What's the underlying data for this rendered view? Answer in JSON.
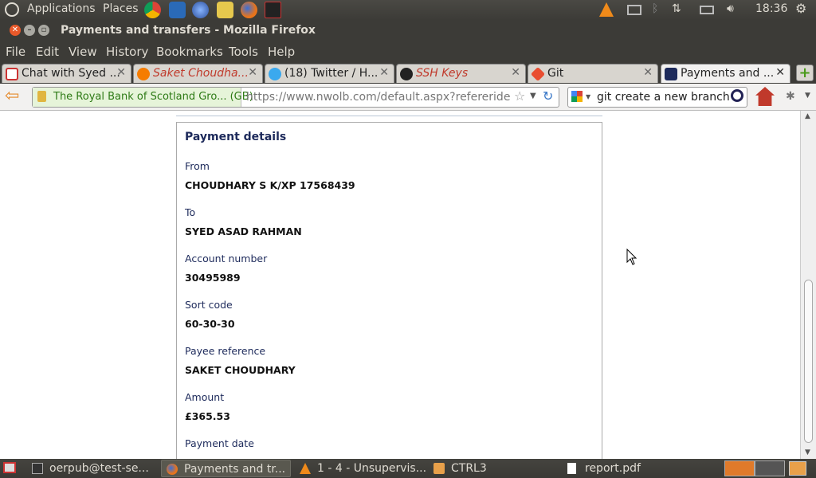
{
  "top_panel": {
    "applications": "Applications",
    "places": "Places",
    "time": "18:36"
  },
  "window": {
    "title": "Payments and transfers - Mozilla Firefox"
  },
  "menu": [
    "File",
    "Edit",
    "View",
    "History",
    "Bookmarks",
    "Tools",
    "Help"
  ],
  "tabs": [
    {
      "label": "Chat with Syed ..."
    },
    {
      "label": "Saket Choudha..."
    },
    {
      "label": "(18) Twitter / H..."
    },
    {
      "label": "SSH Keys"
    },
    {
      "label": "Git"
    },
    {
      "label": "Payments and ..."
    }
  ],
  "navbar": {
    "identity": "The Royal Bank of Scotland Gro... (GB)",
    "url": "https://www.nwolb.com/default.aspx?refererider",
    "search": "git create a new branch"
  },
  "payment": {
    "heading": "Payment details",
    "from_label": "From",
    "from_value": "CHOUDHARY S K/XP 17568439",
    "to_label": "To",
    "to_value": "SYED ASAD RAHMAN",
    "account_label": "Account number",
    "account_value": "30495989",
    "sort_label": "Sort code",
    "sort_value": "60-30-30",
    "payee_ref_label": "Payee reference",
    "payee_ref_value": "SAKET CHOUDHARY",
    "amount_label": "Amount",
    "amount_value": "£365.53",
    "date_label": "Payment date"
  },
  "taskbar": [
    {
      "label": "oerpub@test-se..."
    },
    {
      "label": "Payments and tr..."
    },
    {
      "label": "1 - 4 - Unsupervis..."
    },
    {
      "label": "CTRL3"
    },
    {
      "label": "report.pdf"
    }
  ]
}
